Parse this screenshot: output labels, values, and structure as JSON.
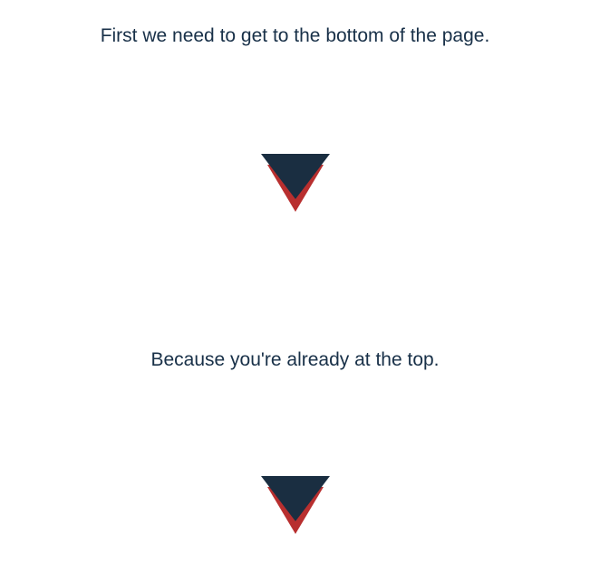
{
  "lines": {
    "first": "First we need to get to the bottom of the page.",
    "second": "Because you're already at the top."
  },
  "colors": {
    "text": "#183048",
    "arrowDark": "#1a2e41",
    "arrowRed": "#b82f2f"
  }
}
